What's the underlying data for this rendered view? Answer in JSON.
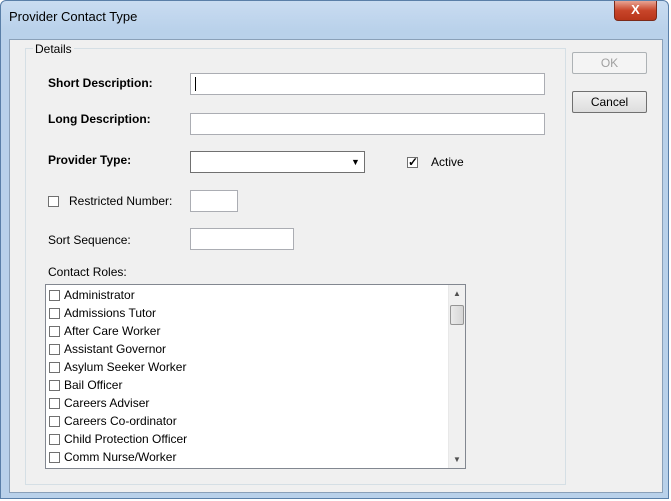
{
  "window": {
    "title": "Provider Contact Type",
    "close_label": "X"
  },
  "details": {
    "group_title": "Details",
    "short_description_label": "Short Description:",
    "short_description_value": "",
    "long_description_label": "Long Description:",
    "long_description_value": "",
    "provider_type_label": "Provider Type:",
    "provider_type_value": "",
    "active_label": "Active",
    "active_checked": true,
    "restricted_number_label": "Restricted Number:",
    "restricted_number_checked": false,
    "restricted_number_value": "",
    "sort_sequence_label": "Sort Sequence:",
    "sort_sequence_value": "",
    "contact_roles_label": "Contact Roles:",
    "contact_roles": [
      "Administrator",
      "Admissions Tutor",
      "After Care Worker",
      "Assistant Governor",
      "Asylum Seeker Worker",
      "Bail Officer",
      "Careers Adviser",
      "Careers Co-ordinator",
      "Child Protection Officer",
      "Comm Nurse/Worker"
    ]
  },
  "buttons": {
    "ok_label": "OK",
    "cancel_label": "Cancel"
  }
}
